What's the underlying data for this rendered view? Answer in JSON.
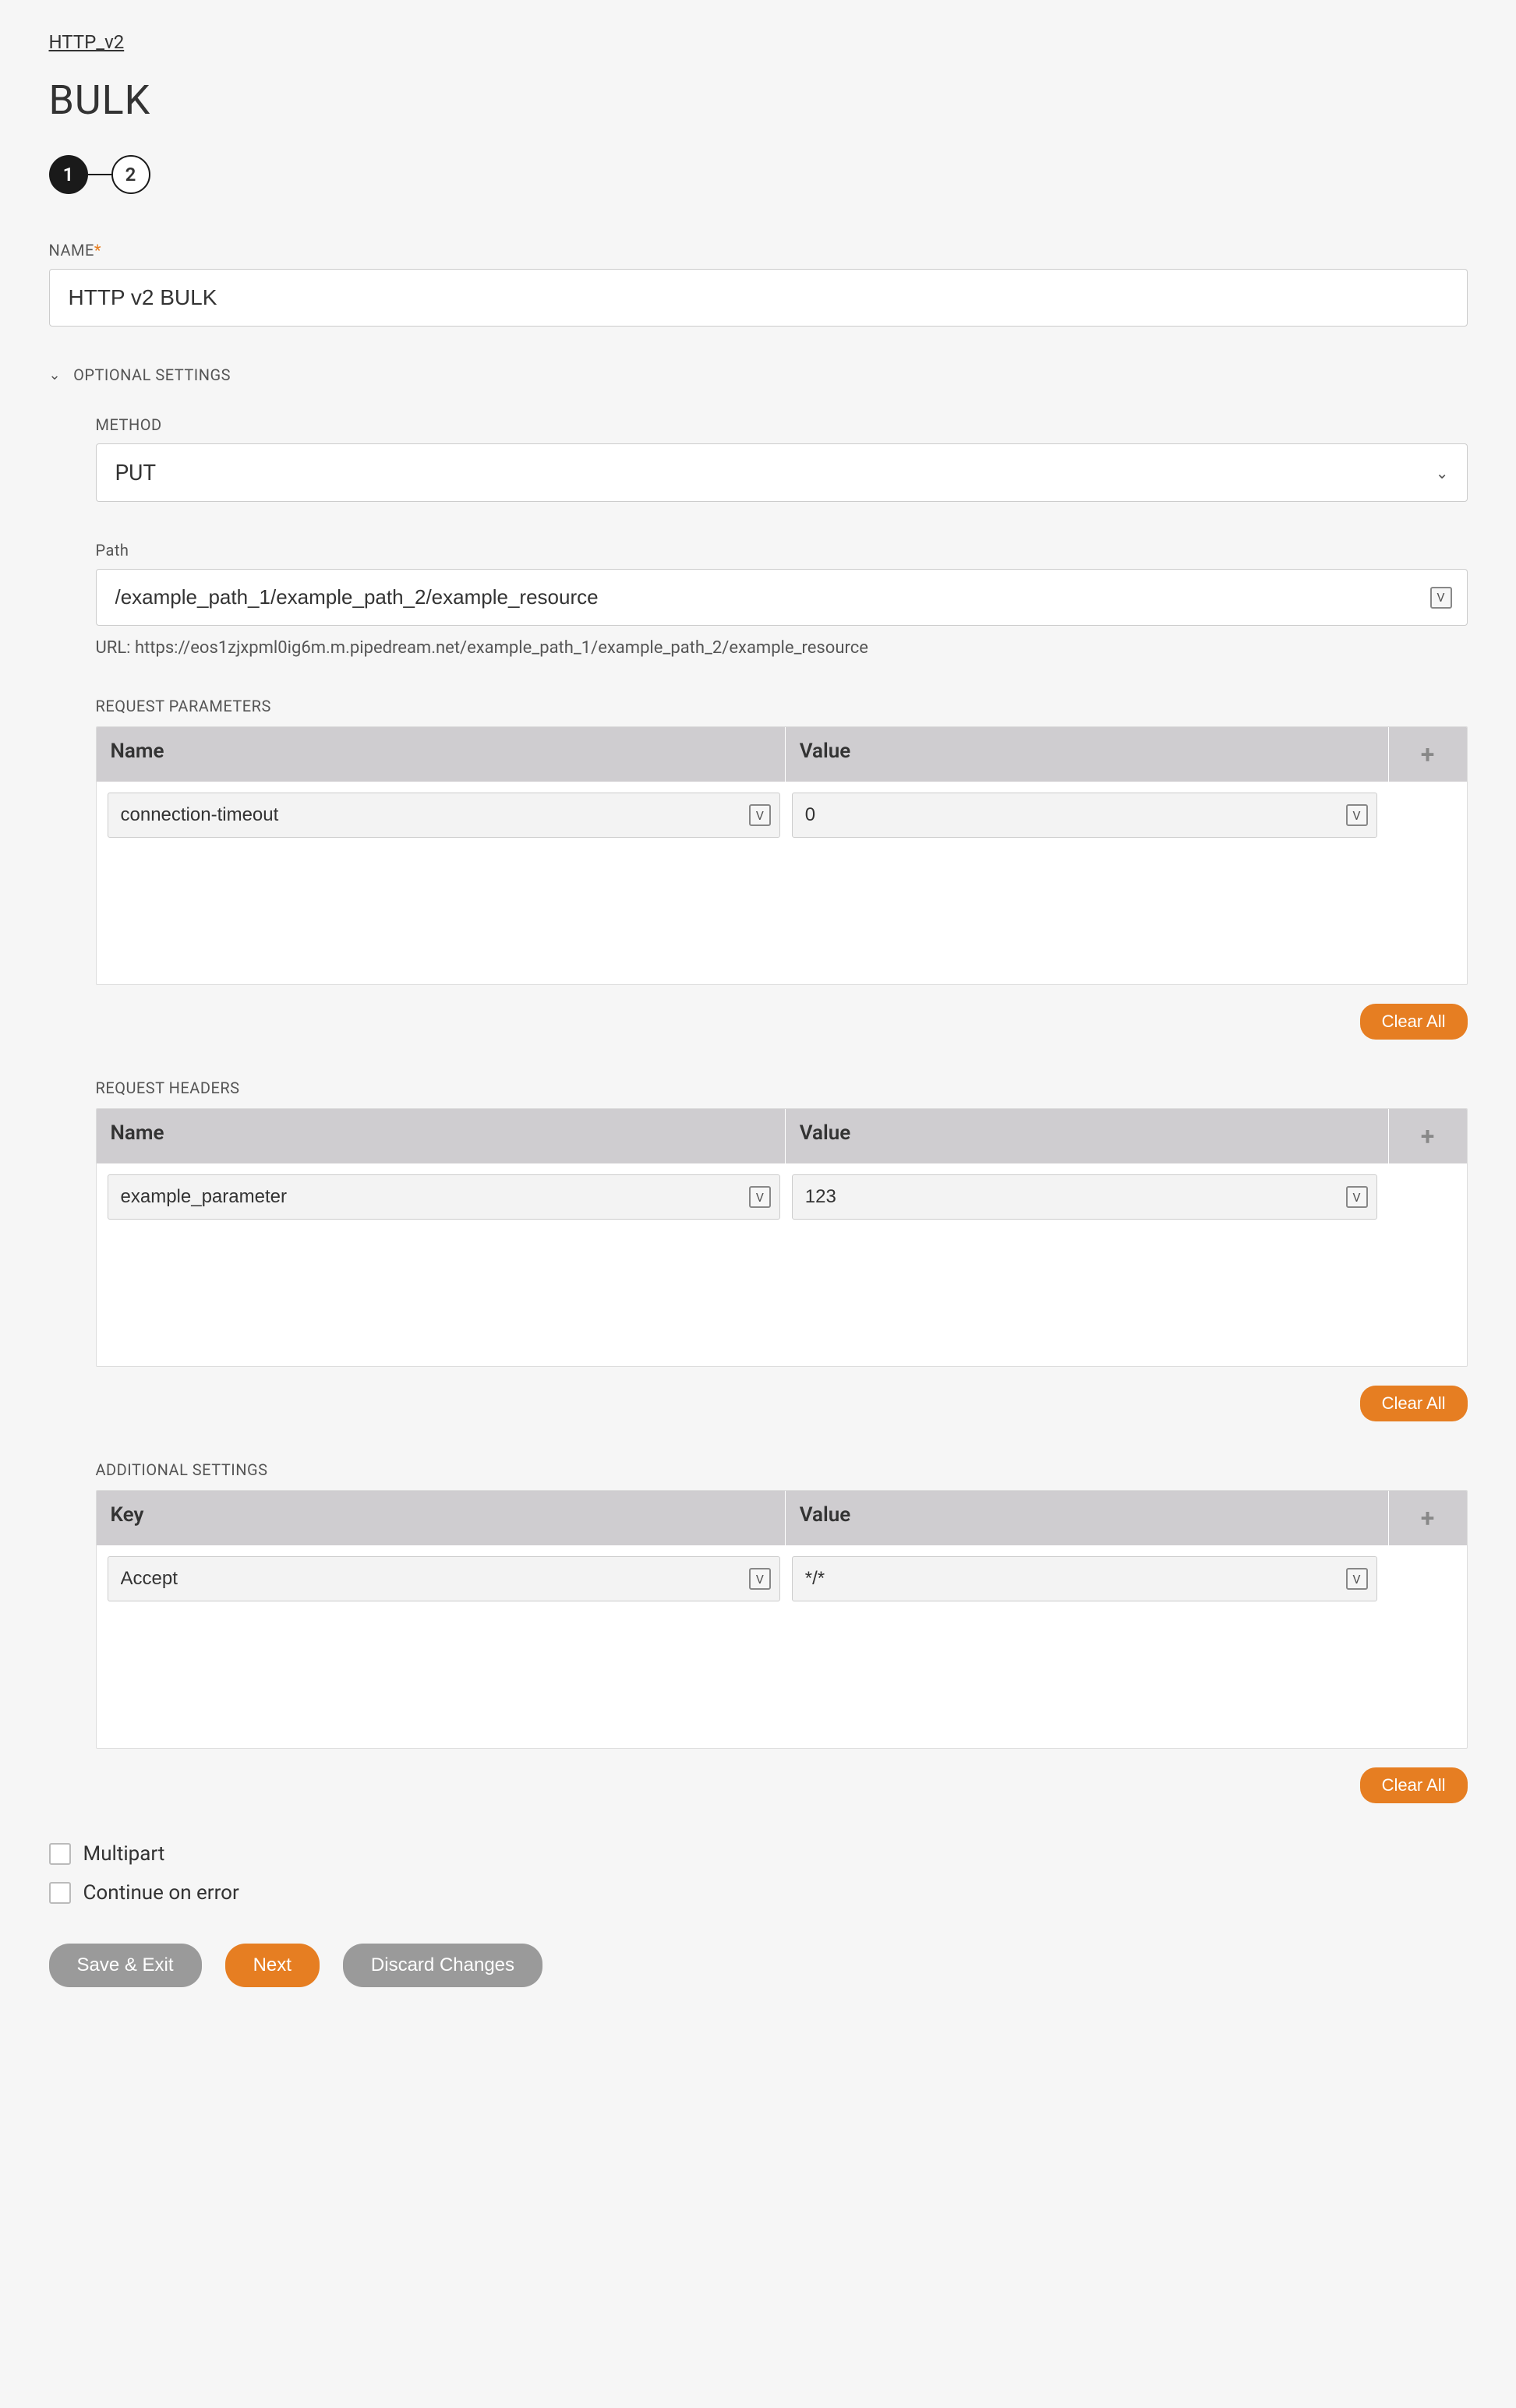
{
  "breadcrumb": "HTTP_v2",
  "title": "BULK",
  "stepper": {
    "step1": "1",
    "step2": "2"
  },
  "name_field": {
    "label": "NAME",
    "value": "HTTP v2 BULK"
  },
  "optional_section_label": "OPTIONAL SETTINGS",
  "method": {
    "label": "METHOD",
    "value": "PUT"
  },
  "path": {
    "label": "Path",
    "value": "/example_path_1/example_path_2/example_resource",
    "url_hint": "URL: https://eos1zjxpml0ig6m.m.pipedream.net/example_path_1/example_path_2/example_resource"
  },
  "variable_badge_text": "V",
  "request_parameters": {
    "label": "REQUEST PARAMETERS",
    "col_name": "Name",
    "col_value": "Value",
    "rows": [
      {
        "name": "connection-timeout",
        "value": "0"
      }
    ]
  },
  "request_headers": {
    "label": "REQUEST HEADERS",
    "col_name": "Name",
    "col_value": "Value",
    "rows": [
      {
        "name": "example_parameter",
        "value": "123"
      }
    ]
  },
  "additional_settings": {
    "label": "ADDITIONAL SETTINGS",
    "col_key": "Key",
    "col_value": "Value",
    "rows": [
      {
        "key": "Accept",
        "value": "*/*"
      }
    ]
  },
  "clear_all_label": "Clear All",
  "checkboxes": {
    "multipart": "Multipart",
    "continue_on_error": "Continue on error"
  },
  "buttons": {
    "save_exit": "Save & Exit",
    "next": "Next",
    "discard": "Discard Changes"
  }
}
